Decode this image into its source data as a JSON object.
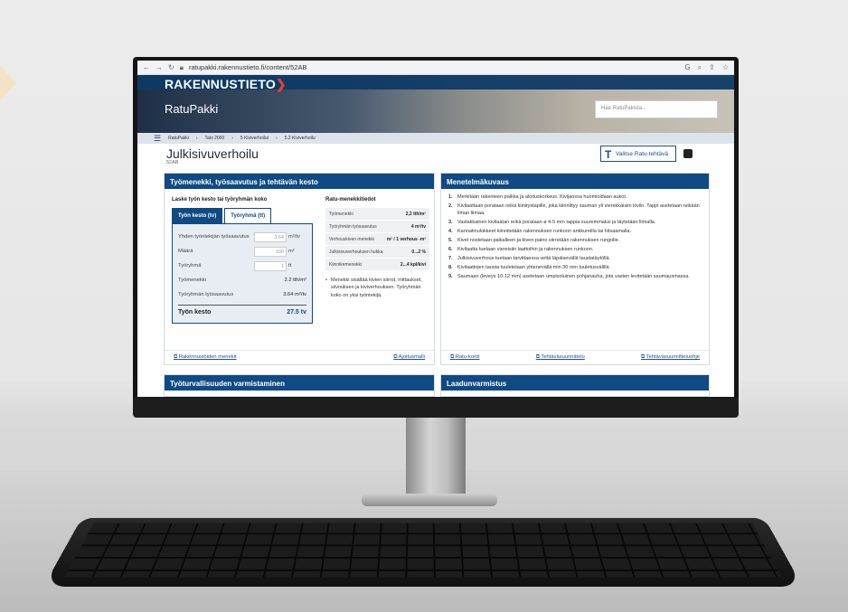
{
  "browser": {
    "url": "ratupakki.rakennustieto.fi/content/52AB"
  },
  "site": {
    "logo": "RAKENNUSTIETO",
    "app": "RatuPakki",
    "search_placeholder": "Hae RatuPakista..."
  },
  "breadcrumb": [
    "RatuPakki",
    "Talo 2000",
    "5 Kiviverhoilut",
    "5.2 Kiviverhoilu"
  ],
  "page": {
    "title": "Julkisivuverhoilu",
    "code": "52AB",
    "select_button": "Valitse Ratu-tehtävä"
  },
  "left_panel": {
    "title": "Työmenekki, työsaavutus ja tehtävän kesto",
    "calc_title": "Laske työn kesto tai työryhmän koko",
    "tabs": [
      "Työn kesto (tv)",
      "Työryhmä (tt)"
    ],
    "rows": [
      {
        "label": "Yhden työntekijän työsaavutus",
        "value": "3.64",
        "unit": "m²/tv"
      },
      {
        "label": "Määrä",
        "value": "100",
        "unit": "m²"
      },
      {
        "label": "Työryhmä",
        "value": "1",
        "unit": "tt"
      }
    ],
    "results": [
      {
        "label": "Työmenekki",
        "value": "2.2 tth/m²"
      },
      {
        "label": "Työryhmän työsaavutus",
        "value": "3.64 m²/tv"
      }
    ],
    "total": {
      "label": "Työn kesto",
      "value": "27.5 tv"
    },
    "ratu_title": "Ratu-menekkitiedot",
    "ratu_rows": [
      {
        "label": "Työmenekki",
        "value": "2,2 tth/m²"
      },
      {
        "label": "Työryhmän työsaavutus",
        "value": "4 m²/tv"
      },
      {
        "label": "Verhouskiven menekki",
        "value": "m² / 1 verhous -m²"
      },
      {
        "label": "Julkisivuverhouksen hukka",
        "value": "0...2 %"
      },
      {
        "label": "Kiinnikemenekki",
        "value": "2...4 kpl/kivi"
      }
    ],
    "ratu_note": "Menekki sisältää kivien siirrot, mittaukset, siivouksen ja kiviverhouksen. Työryhmän koko on yksi työntekijä.",
    "links": [
      "Rakennustöiden menekit",
      "Ajoitusmalli"
    ]
  },
  "right_panel": {
    "title": "Menetelmäkuvaus",
    "steps": [
      "Merkitään rakenteen paikka ja aloituskorkeus. Kivijaossa huomioidaan aukot.",
      "Kivilaattaan porataan reikä kiinitystapille, joka kiinnittyy sauman yli vierekkäisiin kiviin. Tappi asetetaan reikään ilman liimaa.",
      "Vastakkainen kivilaatan reikä porataan ø 4-5 mm tappia suuremmaksi ja täytetään liimalla.",
      "Kannatinulokkeet kiinnitetään rakennuksen runkoon ankkureilla tai hitsaamalla.",
      "Kivet nostetaan paikalleen ja kiven paino siirretään rakennuksen rungolle.",
      "Kivilaatta tuetaan viereisiin laattoihin ja rakennuksen runkoon.",
      "Julkisivuverhous tuetaan tarvittaessa vettä läpäisevällä taustatäytöllä.",
      "Kivilaattojen tausta tuuletetaan yhtenevällä min 30 mm tuuletusvälillä.",
      "Saumaan (leveys 10-12 mm) asetetaan umpisoluinen pohjanauha, jota vasten levitetään saumausmassa."
    ],
    "links": [
      "Ratu-kortti",
      "Tehtäväsuunnittelu",
      "Tehtäväsuunnitteluohje"
    ]
  },
  "bottom_panels": [
    "Työturvallisuuden varmistaminen",
    "Laadunvarmistus"
  ]
}
